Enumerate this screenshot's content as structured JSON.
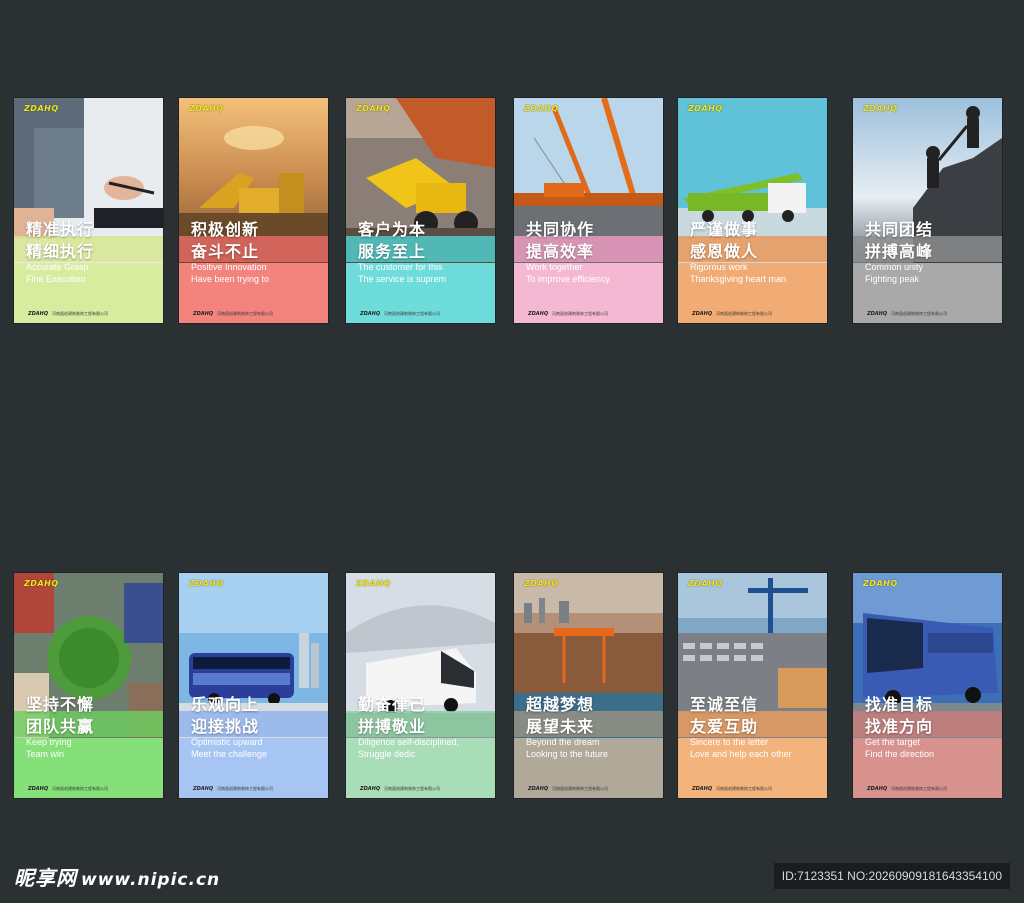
{
  "cards": [
    {
      "title1": "精准执行",
      "title2": "精细执行",
      "en1": "Accurate Grasp",
      "en2": "Fine  Execution",
      "lower": "#d8eca0",
      "band": "#d6e58e",
      "photo": "office"
    },
    {
      "title1": "积极创新",
      "title2": "奋斗不止",
      "en1": "Positive  Innovation",
      "en2": "Have been trying to",
      "lower": "#f2837d",
      "band": "#e86a66",
      "photo": "excavator-sunset"
    },
    {
      "title1": "客户为本",
      "title2": "服务至上",
      "en1": "The  customer  for  this",
      "en2": "The service is suprem",
      "lower": "#6fdcdc",
      "band": "#4fd0d0",
      "photo": "loader"
    },
    {
      "title1": "共同协作",
      "title2": "提高效率",
      "en1": "Work together",
      "en2": "To improve efficiency",
      "lower": "#f5b8d3",
      "band": "#f09cc2",
      "photo": "cranes"
    },
    {
      "title1": "严谨做事",
      "title2": "感恩做人",
      "en1": "Rigorous work",
      "en2": "Thanksgiving heart man",
      "lower": "#f0ac74",
      "band": "#ea9656",
      "photo": "pump-truck"
    },
    {
      "title1": "共同团结",
      "title2": "拼搏高峰",
      "en1": "Common unity",
      "en2": "Fighting peak",
      "lower": "#a9a9a9",
      "band": "#8f8f8f",
      "photo": "climbers"
    },
    {
      "title1": "坚持不懈",
      "title2": "团队共赢",
      "en1": "Keep trying",
      "en2": "Team win",
      "lower": "#86e07a",
      "band": "#6fd062",
      "photo": "hands-circle"
    },
    {
      "title1": "乐观向上",
      "title2": "迎接挑战",
      "en1": "Optimistic upward",
      "en2": "Meet the challenge",
      "lower": "#a7c5f2",
      "band": "#8fb2ec",
      "photo": "double-decker"
    },
    {
      "title1": "勤奋律己",
      "title2": "拼搏敬业",
      "en1": "Diligence self-disciplined,",
      "en2": "Struggle dedic",
      "lower": "#a8ddb8",
      "band": "#8ecfa2",
      "photo": "coach-white"
    },
    {
      "title1": "超越梦想",
      "title2": "展望未来",
      "en1": "Beyond the dream",
      "en2": "Looking to the future",
      "lower": "#b0a99a",
      "band": "#9a9283",
      "photo": "port"
    },
    {
      "title1": "至诚至信",
      "title2": "友爱互助",
      "en1": "Sincere to the letter",
      "en2": "Love and help each other",
      "lower": "#f2b37c",
      "band": "#ec9e5e",
      "photo": "car-terminal"
    },
    {
      "title1": "找准目标",
      "title2": "找准方向",
      "en1": "Get the target",
      "en2": "Find the direction",
      "lower": "#d8928e",
      "band": "#cc7e7a",
      "photo": "coach-blue"
    }
  ],
  "brand_logo": "ZDAHQ",
  "footer_text": "河南昌创建筑装饰工程有限公司",
  "watermark": {
    "site": "昵享网",
    "url": "www.nipic.cn",
    "id": "ID:7123351 NO:20260909181643354100"
  }
}
